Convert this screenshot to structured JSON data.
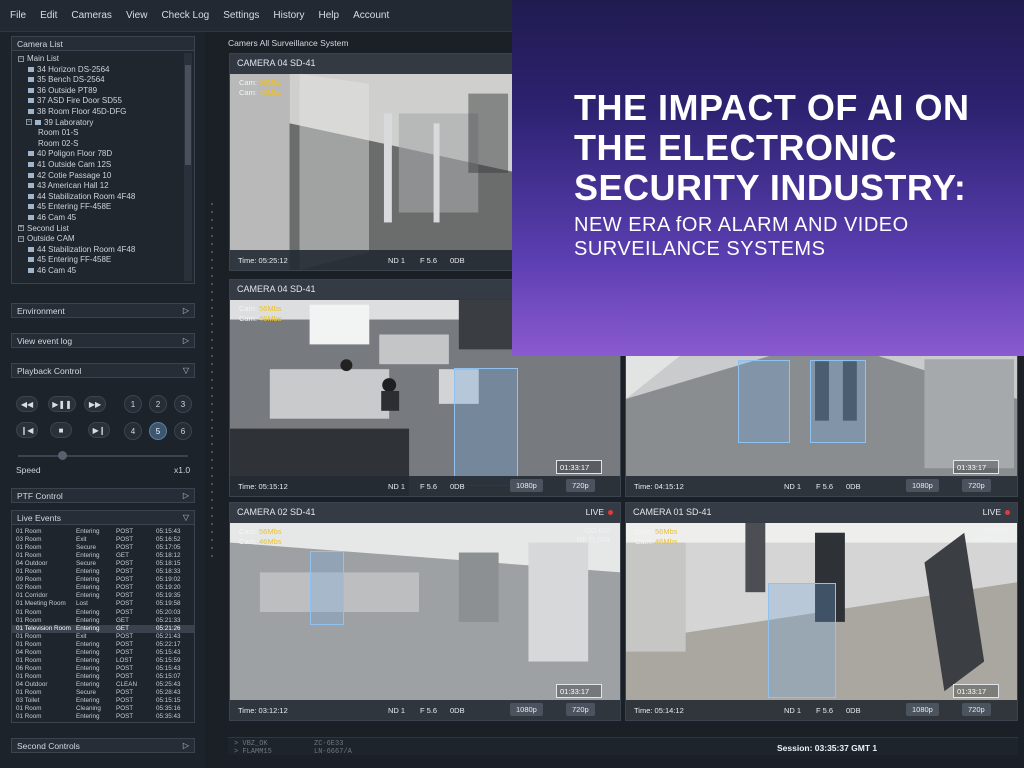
{
  "menu": [
    "File",
    "Edit",
    "Cameras",
    "View",
    "Check Log",
    "Settings",
    "History",
    "Help",
    "Account"
  ],
  "sidebar": {
    "camera_list_title": "Camera List",
    "tree": [
      {
        "label": "Main List",
        "type": "group",
        "toggle": "−"
      },
      {
        "label": "34 Horizon DS-2564",
        "type": "cam"
      },
      {
        "label": "35 Bench DS-2564",
        "type": "cam"
      },
      {
        "label": "36 Outside PT89",
        "type": "cam"
      },
      {
        "label": "37 ASD Fire Door SD55",
        "type": "cam"
      },
      {
        "label": "38 Room Floor 45D-DFG",
        "type": "cam"
      },
      {
        "label": "39 Laboratory",
        "type": "subgroup",
        "toggle": "−"
      },
      {
        "label": "Room 01-S",
        "type": "room"
      },
      {
        "label": "Room 02-S",
        "type": "room"
      },
      {
        "label": "40 Poligon Floor 78D",
        "type": "cam"
      },
      {
        "label": "41 Outside Cam 12S",
        "type": "cam"
      },
      {
        "label": "42 Cotie Passage 10",
        "type": "cam"
      },
      {
        "label": "43 American Hall 12",
        "type": "cam"
      },
      {
        "label": "44 Stabilization Room 4F48",
        "type": "cam"
      },
      {
        "label": "45 Entering FF-458E",
        "type": "cam"
      },
      {
        "label": "46 Cam 45",
        "type": "cam"
      },
      {
        "label": "Second List",
        "type": "group",
        "toggle": "+"
      },
      {
        "label": "Outside CAM",
        "type": "group",
        "toggle": "−"
      },
      {
        "label": "44 Stabilization Room 4F48",
        "type": "cam"
      },
      {
        "label": "45 Entering FF-458E",
        "type": "cam"
      },
      {
        "label": "46 Cam 45",
        "type": "cam"
      }
    ],
    "environment": "Environment",
    "view_event_log": "View event log",
    "playback_control": "Playback Control",
    "transport": {
      "rewind": "◀◀",
      "play_pause": "▶❚❚",
      "forward": "▶▶",
      "prev": "❙◀",
      "stop": "■",
      "next": "▶❙"
    },
    "numbers": [
      "1",
      "2",
      "3",
      "4",
      "5",
      "6"
    ],
    "active_number": "5",
    "speed_label": "Speed",
    "speed_value": "x1.0",
    "ptf_control": "PTF Control",
    "live_events": "Live Events",
    "second_controls": "Second Controls",
    "arrow_right": "▷",
    "arrow_down": "▽"
  },
  "events": [
    [
      "01 Room",
      "Entering",
      "POST",
      "05:15:43"
    ],
    [
      "03 Room",
      "Exit",
      "POST",
      "05:16:52"
    ],
    [
      "01 Room",
      "Secure",
      "POST",
      "05:17:05"
    ],
    [
      "01 Room",
      "Entering",
      "GET",
      "05:18:12"
    ],
    [
      "04 Outdoor",
      "Secure",
      "POST",
      "05:18:15"
    ],
    [
      "01 Room",
      "Entering",
      "POST",
      "05:18:33"
    ],
    [
      "09 Room",
      "Entering",
      "POST",
      "05:19:02"
    ],
    [
      "02 Room",
      "Entering",
      "POST",
      "05:19:20"
    ],
    [
      "01 Corridor",
      "Entering",
      "POST",
      "05:19:35"
    ],
    [
      "01 Meeting Room",
      "Lost",
      "POST",
      "05:19:58"
    ],
    [
      "01 Room",
      "Entering",
      "POST",
      "05:20:03"
    ],
    [
      "01 Room",
      "Entering",
      "GET",
      "05:21:33"
    ],
    [
      "01 Television Room",
      "Entering",
      "GET",
      "05:21:26"
    ],
    [
      "01 Room",
      "Exit",
      "POST",
      "05:21:43"
    ],
    [
      "01 Room",
      "Entering",
      "POST",
      "05:22:17"
    ],
    [
      "04 Room",
      "Entering",
      "POST",
      "05:15:43"
    ],
    [
      "01 Room",
      "Entering",
      "LOST",
      "05:15:59"
    ],
    [
      "06 Room",
      "Entering",
      "POST",
      "05:15:43"
    ],
    [
      "01 Room",
      "Entering",
      "POST",
      "05:15:07"
    ],
    [
      "04 Outdoor",
      "Entering",
      "CLEAN",
      "05:25:43"
    ],
    [
      "01 Room",
      "Secure",
      "POST",
      "05:28:43"
    ],
    [
      "03 Toilet",
      "Entering",
      "POST",
      "05:15:15"
    ],
    [
      "01 Room",
      "Cleaning",
      "POST",
      "05:35:16"
    ],
    [
      "01 Room",
      "Entering",
      "POST",
      "05:35:43"
    ]
  ],
  "selected_event": 12,
  "main_title": "Camers All Surveillance System",
  "cameras": [
    {
      "name": "CAMERA 04 SD-41",
      "cam_label": "Cam:",
      "rate": "56Mbs",
      "rate2": "46Mbs",
      "time": "Time: 05:25:12",
      "nd": "ND 1",
      "f": "F 5.6",
      "db": "0DB"
    },
    {
      "name": "CAMERA 04 SD-41",
      "cam_label": "Cam:",
      "rate": "56Mbs",
      "rate2": "46Mbs",
      "time": "Time: 05:15:12",
      "nd": "ND 1",
      "f": "F 5.6",
      "db": "0DB",
      "res": "1080p",
      "stamp": "01:33:17",
      "res2": "720p"
    },
    {
      "time": "Time: 04:15:12",
      "nd": "ND 1",
      "f": "F 5.6",
      "db": "0DB",
      "res": "1080p",
      "stamp": "01:33:17",
      "res2": "720p"
    },
    {
      "name": "CAMERA 02 SD-41",
      "live": "LIVE",
      "cam_label": "Cam:",
      "rate": "56Mbs",
      "rate2": "46Mbs",
      "iso": "ISO 600",
      "mf": "MF TLSS4",
      "time": "Time: 03:12:12",
      "nd": "ND 1",
      "f": "F 5.6",
      "db": "0DB",
      "res": "1080p",
      "stamp": "01:33:17",
      "res2": "720p"
    },
    {
      "name": "CAMERA 01 SD-41",
      "live": "LIVE",
      "cam_label": "Cam:",
      "rate": "56Mbs",
      "rate2": "46Mbs",
      "iso": "ISO 600",
      "mf": "MF TLSS4",
      "time": "Time: 05:14:12",
      "nd": "ND 1",
      "f": "F 5.6",
      "db": "0DB",
      "res": "1080p",
      "stamp": "01:33:17",
      "res2": "720p"
    }
  ],
  "overlay": {
    "title": "THE IMPACT OF AI ON THE ELECTRONIC SECURITY INDUSTRY:",
    "subtitle": "NEW ERA fOR ALARM AND VIDEO SURVEILANCE SYSTEMS"
  },
  "status": {
    "left_line1": "> VBZ_OK",
    "left_line2": "> FLAMM15",
    "mid_line1": "ZC-6E33",
    "mid_line2": "LN-6667/A",
    "session": "Session: 03:35:37 GMT 1"
  }
}
